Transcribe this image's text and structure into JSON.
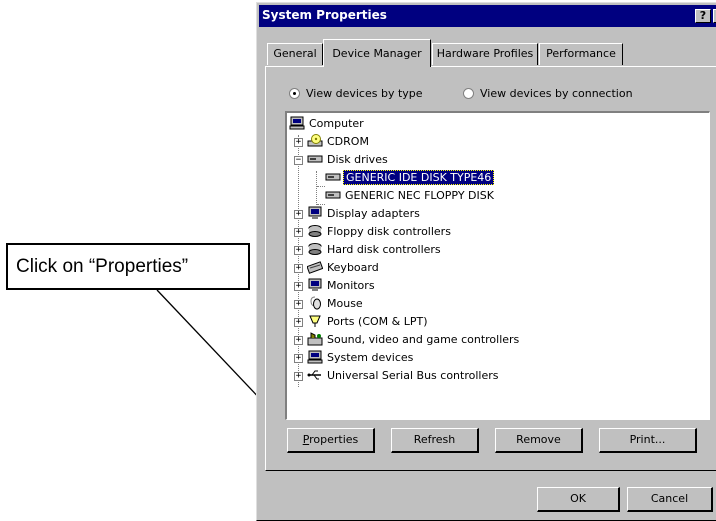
{
  "callout": {
    "text": "Click on “Properties”"
  },
  "window": {
    "title": "System Properties",
    "help": "?",
    "close": "✕"
  },
  "tabs": [
    {
      "label": "General"
    },
    {
      "label": "Device Manager"
    },
    {
      "label": "Hardware Profiles"
    },
    {
      "label": "Performance"
    }
  ],
  "radios": [
    {
      "label": "View devices by type",
      "selected": true
    },
    {
      "label": "View devices by connection",
      "selected": false
    }
  ],
  "tree": [
    {
      "label": "Computer",
      "icon": "computer-icon"
    },
    {
      "label": "CDROM",
      "icon": "cdrom-icon"
    },
    {
      "label": "Disk drives",
      "icon": "disk-drive-icon"
    },
    {
      "label": "GENERIC IDE  DISK TYPE46",
      "icon": "disk-drive-icon",
      "selected": true
    },
    {
      "label": "GENERIC NEC  FLOPPY DISK",
      "icon": "disk-drive-icon"
    },
    {
      "label": "Display adapters",
      "icon": "monitor-icon"
    },
    {
      "label": "Floppy disk controllers",
      "icon": "controller-icon"
    },
    {
      "label": "Hard disk controllers",
      "icon": "controller-icon"
    },
    {
      "label": "Keyboard",
      "icon": "keyboard-icon"
    },
    {
      "label": "Monitors",
      "icon": "monitor-icon"
    },
    {
      "label": "Mouse",
      "icon": "mouse-icon"
    },
    {
      "label": "Ports (COM & LPT)",
      "icon": "port-icon"
    },
    {
      "label": "Sound, video and game controllers",
      "icon": "sound-icon"
    },
    {
      "label": "System devices",
      "icon": "system-icon"
    },
    {
      "label": "Universal Serial Bus controllers",
      "icon": "usb-icon"
    }
  ],
  "buttons": {
    "properties": "Properties",
    "refresh": "Refresh",
    "remove": "Remove",
    "print": "Print...",
    "ok": "OK",
    "cancel": "Cancel"
  },
  "colors": {
    "titlebar": "#000080",
    "face": "#c0c0c0",
    "selection": "#000080"
  }
}
